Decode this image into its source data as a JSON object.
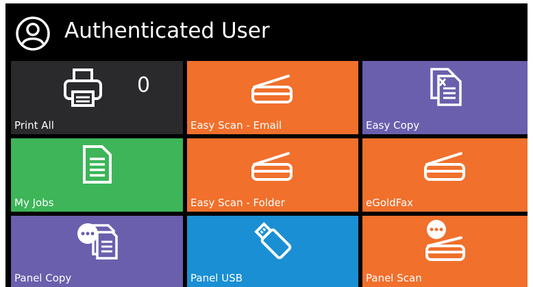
{
  "header": {
    "title": "Authenticated User",
    "icon": "user-circle-icon"
  },
  "colors": {
    "background": "#000000",
    "dark_tile": "#2a2a2c",
    "orange": "#f0702c",
    "purple": "#6a5fad",
    "green": "#3db558",
    "blue": "#1a8fd3"
  },
  "tiles": [
    {
      "label": "Print All",
      "icon": "printer-icon",
      "count": "0",
      "color": "#2a2a2c"
    },
    {
      "label": "Easy Scan - Email",
      "icon": "scanner-icon",
      "color": "#f0702c"
    },
    {
      "label": "Easy Copy",
      "icon": "copy-document-icon",
      "color": "#6a5fad"
    },
    {
      "label": "My Jobs",
      "icon": "document-icon",
      "color": "#3db558"
    },
    {
      "label": "Easy Scan - Folder",
      "icon": "scanner-icon",
      "color": "#f0702c"
    },
    {
      "label": "eGoldFax",
      "icon": "scanner-icon",
      "color": "#f0702c"
    },
    {
      "label": "Panel Copy",
      "icon": "panel-copy-icon",
      "color": "#6a5fad"
    },
    {
      "label": "Panel USB",
      "icon": "usb-drive-icon",
      "color": "#1a8fd3"
    },
    {
      "label": "Panel Scan",
      "icon": "panel-scan-icon",
      "color": "#f0702c"
    }
  ]
}
